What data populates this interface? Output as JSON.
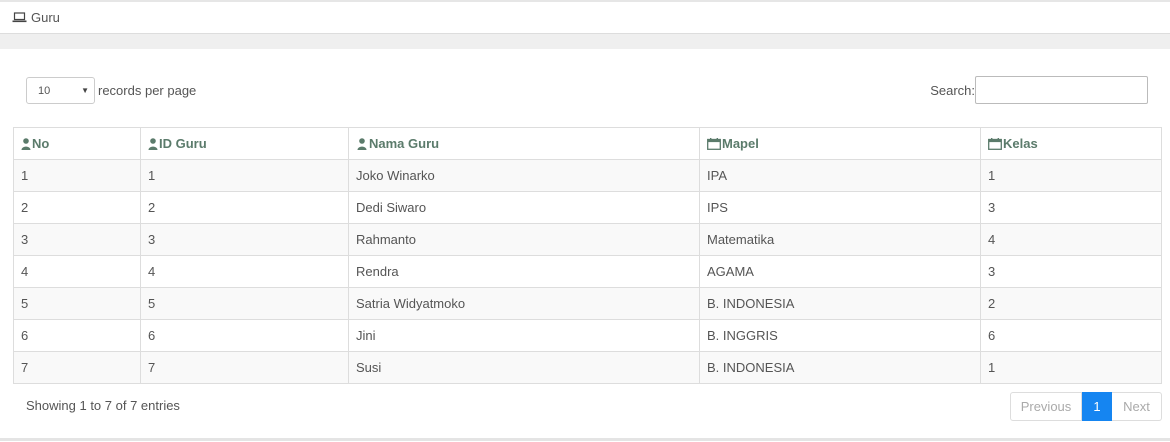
{
  "breadcrumb": {
    "icon": "laptop-icon",
    "label": "Guru"
  },
  "length_menu": {
    "selected": "10",
    "suffix": "records per page"
  },
  "search": {
    "label": "Search:",
    "value": ""
  },
  "table": {
    "columns": [
      {
        "label": "No",
        "icon": "user-icon"
      },
      {
        "label": "ID Guru",
        "icon": "user-icon"
      },
      {
        "label": "Nama Guru",
        "icon": "user-icon"
      },
      {
        "label": "Mapel",
        "icon": "calendar-icon"
      },
      {
        "label": "Kelas",
        "icon": "calendar-icon"
      }
    ],
    "rows": [
      [
        "1",
        "1",
        "Joko Winarko",
        "IPA",
        "1"
      ],
      [
        "2",
        "2",
        "Dedi Siwaro",
        "IPS",
        "3"
      ],
      [
        "3",
        "3",
        "Rahmanto",
        "Matematika",
        "4"
      ],
      [
        "4",
        "4",
        "Rendra",
        "AGAMA",
        "3"
      ],
      [
        "5",
        "5",
        "Satria Widyatmoko",
        "B. INDONESIA",
        "2"
      ],
      [
        "6",
        "6",
        "Jini",
        "B. INGGRIS",
        "6"
      ],
      [
        "7",
        "7",
        "Susi",
        "B. INDONESIA",
        "1"
      ]
    ]
  },
  "info": "Showing 1 to 7 of 7 entries",
  "pagination": {
    "previous": "Previous",
    "current": "1",
    "next": "Next"
  },
  "colors": {
    "header_text": "#5b7b6b",
    "active_page": "#1585f1"
  }
}
